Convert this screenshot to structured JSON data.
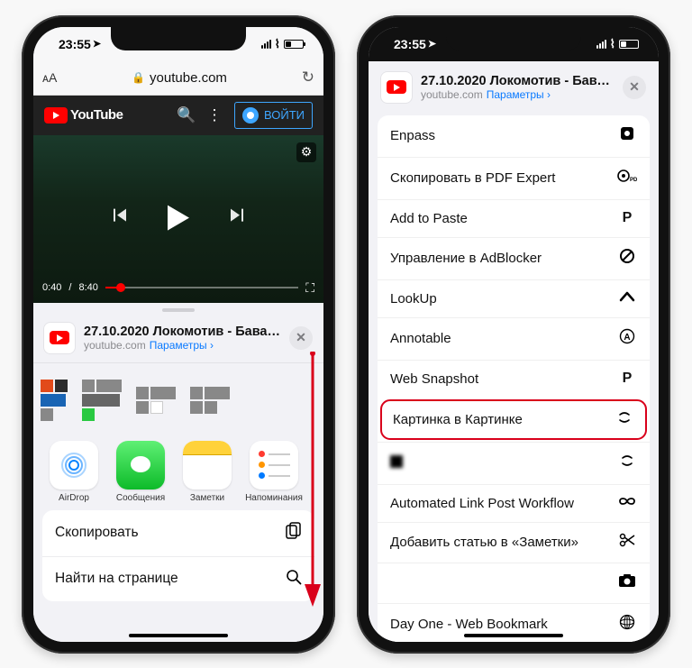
{
  "status": {
    "time": "23:55"
  },
  "safari": {
    "aa": "ᴀA",
    "url": "youtube.com"
  },
  "youtube": {
    "brand": "YouTube",
    "signin": "ВОЙТИ",
    "time_current": "0:40",
    "time_total": "8:40"
  },
  "share": {
    "title": "27.10.2020 Локомотив - Бавари…",
    "domain": "youtube.com",
    "params": "Параметры",
    "apps": [
      {
        "label": "AirDrop"
      },
      {
        "label": "Сообщения"
      },
      {
        "label": "Заметки"
      },
      {
        "label": "Напоминания"
      }
    ],
    "actions": [
      {
        "label": "Скопировать",
        "icon": "⧉"
      },
      {
        "label": "Найти на странице",
        "icon": "🔍"
      }
    ]
  },
  "p2": {
    "rows": [
      {
        "label": "Enpass",
        "icon": "◉"
      },
      {
        "label": "Скопировать в PDF Expert",
        "icon": "▣"
      },
      {
        "label": "Add to Paste",
        "icon": "P"
      },
      {
        "label": "Управление в AdBlocker",
        "icon": "⊘"
      },
      {
        "label": "LookUp",
        "icon": "˄"
      },
      {
        "label": "Annotable",
        "icon": "Ⓐ"
      },
      {
        "label": "Web Snapshot",
        "icon": "P"
      },
      {
        "label": "Картинка в Картинке",
        "icon": "⌘",
        "highlight": true
      },
      {
        "label": "████",
        "icon": "⌘",
        "blurred": true
      },
      {
        "label": "Automated Link Post Workflow",
        "icon": "∞"
      },
      {
        "label": "Добавить статью в «Заметки»",
        "icon": "✄"
      },
      {
        "label": "",
        "icon": "📷",
        "blurred": true
      },
      {
        "label": "Day One - Web Bookmark",
        "icon": "⊕"
      }
    ]
  }
}
